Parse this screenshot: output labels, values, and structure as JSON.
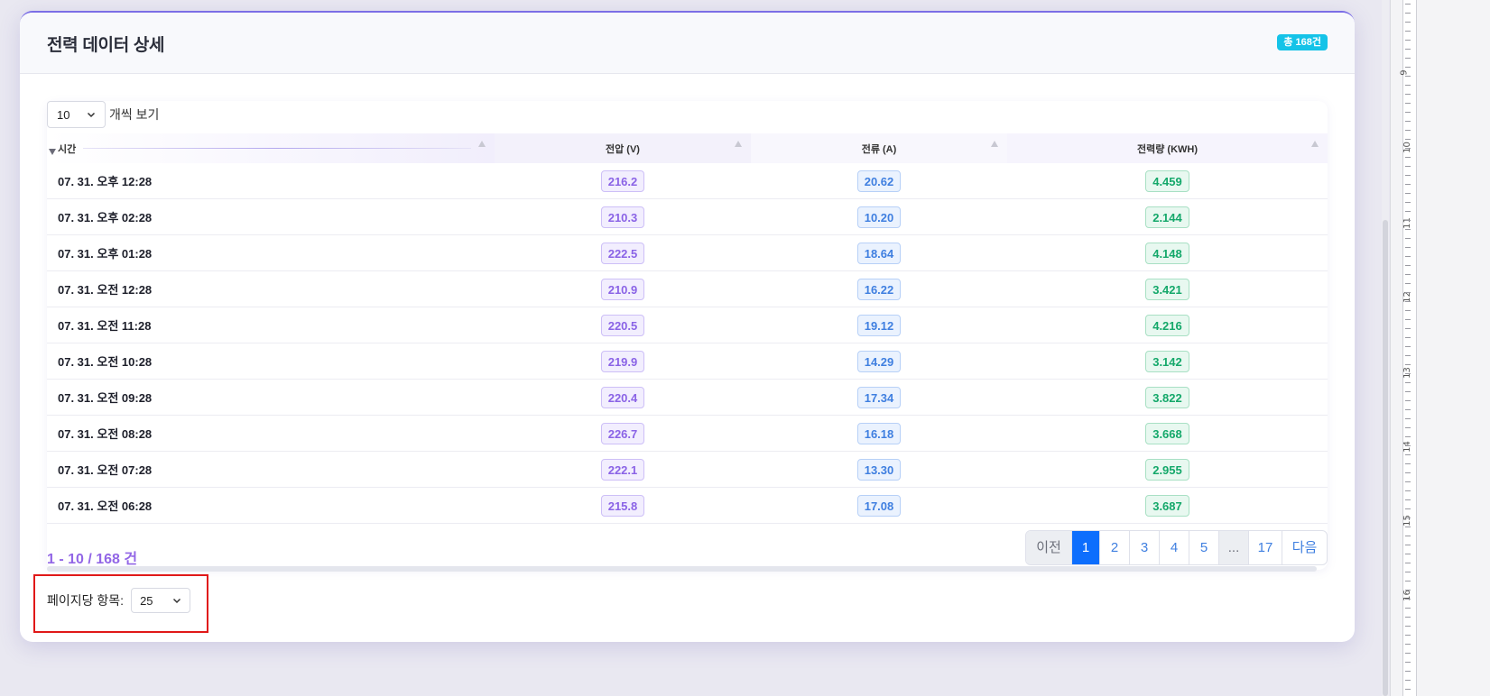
{
  "card": {
    "title": "전력 데이터 상세",
    "total_badge": "총 168건"
  },
  "length_control": {
    "value": "10",
    "suffix": "개씩 보기"
  },
  "table": {
    "headers": [
      "시간",
      "전압 (V)",
      "전류 (A)",
      "전력량 (KWH)"
    ],
    "rows": [
      {
        "time": "07. 31. 오후 12:28",
        "voltage": "216.2",
        "current": "20.62",
        "energy": "4.459"
      },
      {
        "time": "07. 31. 오후 02:28",
        "voltage": "210.3",
        "current": "10.20",
        "energy": "2.144"
      },
      {
        "time": "07. 31. 오후 01:28",
        "voltage": "222.5",
        "current": "18.64",
        "energy": "4.148"
      },
      {
        "time": "07. 31. 오전 12:28",
        "voltage": "210.9",
        "current": "16.22",
        "energy": "3.421"
      },
      {
        "time": "07. 31. 오전 11:28",
        "voltage": "220.5",
        "current": "19.12",
        "energy": "4.216"
      },
      {
        "time": "07. 31. 오전 10:28",
        "voltage": "219.9",
        "current": "14.29",
        "energy": "3.142"
      },
      {
        "time": "07. 31. 오전 09:28",
        "voltage": "220.4",
        "current": "17.34",
        "energy": "3.822"
      },
      {
        "time": "07. 31. 오전 08:28",
        "voltage": "226.7",
        "current": "16.18",
        "energy": "3.668"
      },
      {
        "time": "07. 31. 오전 07:28",
        "voltage": "222.1",
        "current": "13.30",
        "energy": "2.955"
      },
      {
        "time": "07. 31. 오전 06:28",
        "voltage": "215.8",
        "current": "17.08",
        "energy": "3.687"
      }
    ]
  },
  "info_text": "1 - 10 / 168 건",
  "pagination": {
    "prev": "이전",
    "pages": [
      "1",
      "2",
      "3",
      "4",
      "5"
    ],
    "ellipsis": "...",
    "last": "17",
    "next": "다음",
    "active": "1"
  },
  "per_page": {
    "label": "페이지당 항목:",
    "value": "25"
  },
  "ruler_numbers": [
    "9",
    "10",
    "11",
    "12",
    "13",
    "14",
    "15",
    "16"
  ],
  "colors": {
    "voltage": "#8a63e6",
    "current": "#3f7fe0",
    "energy": "#14a86a",
    "badge": "#15c3e8",
    "active_page": "#0d6efd",
    "highlight": "#e01818"
  }
}
